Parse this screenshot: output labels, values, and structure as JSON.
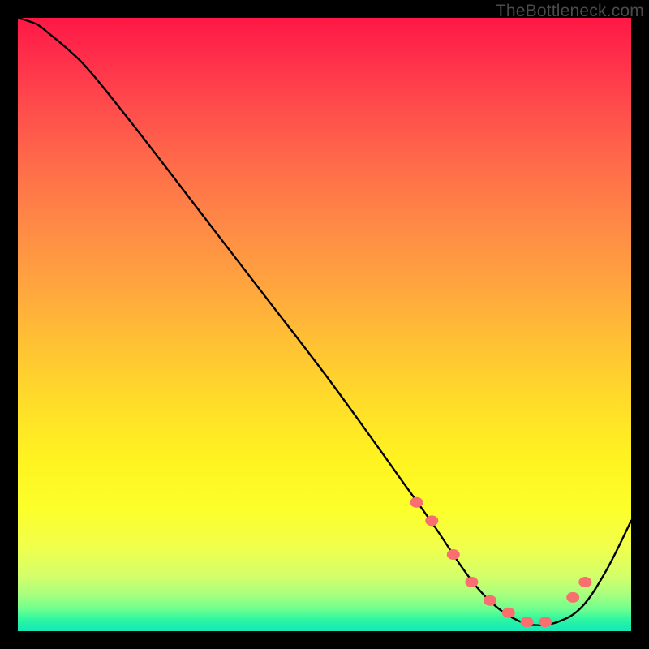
{
  "watermark": "TheBottleneck.com",
  "chart_data": {
    "type": "line",
    "title": "",
    "xlabel": "",
    "ylabel": "",
    "xlim": [
      0,
      100
    ],
    "ylim": [
      0,
      100
    ],
    "grid": false,
    "legend": false,
    "series": [
      {
        "name": "bottleneck-curve",
        "x": [
          0,
          3,
          5,
          8,
          12,
          20,
          30,
          40,
          50,
          58,
          63,
          68,
          72,
          75,
          78,
          81,
          84,
          88,
          92,
          96,
          100
        ],
        "values": [
          100,
          99,
          97.5,
          95,
          91,
          81,
          68,
          55,
          42,
          31,
          24,
          17,
          11,
          7,
          4,
          2,
          1,
          1.5,
          4,
          10,
          18
        ]
      }
    ],
    "markers": {
      "name": "valley-dots",
      "x": [
        65,
        67.5,
        71,
        74,
        77,
        80,
        83,
        86,
        90.5,
        92.5
      ],
      "values": [
        21,
        18,
        12.5,
        8,
        5,
        3,
        1.5,
        1.5,
        5.5,
        8
      ]
    },
    "background_gradient": {
      "top_color": "#ff1846",
      "mid_top": "#ffa63e",
      "mid": "#fff321",
      "mid_bottom": "#a8ff7e",
      "bottom_color": "#17e6b8"
    }
  }
}
